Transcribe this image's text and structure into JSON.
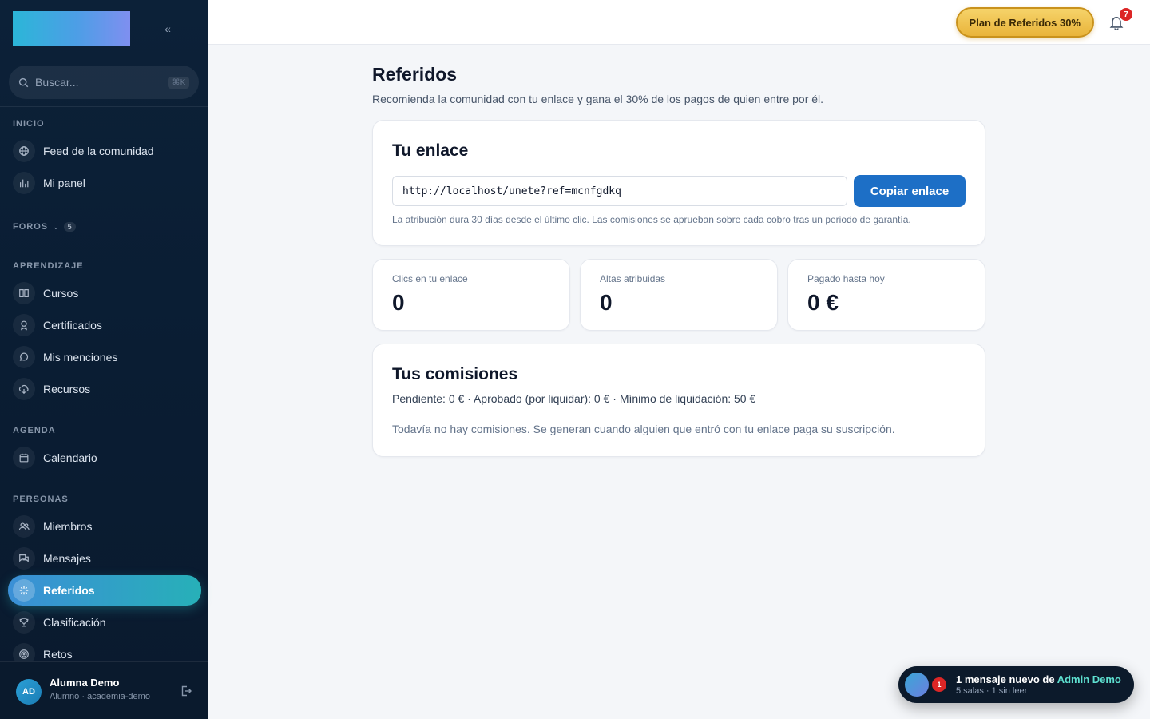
{
  "sidebar": {
    "search": {
      "placeholder": "Buscar...",
      "shortcut": "⌘K"
    },
    "sections": {
      "inicio": "INICIO",
      "foros": "FOROS",
      "foros_count": "5",
      "aprendizaje": "APRENDIZAJE",
      "agenda": "AGENDA",
      "personas": "PERSONAS"
    },
    "items": {
      "feed": "Feed de la comunidad",
      "panel": "Mi panel",
      "cursos": "Cursos",
      "certificados": "Certificados",
      "menciones": "Mis menciones",
      "recursos": "Recursos",
      "calendario": "Calendario",
      "miembros": "Miembros",
      "mensajes": "Mensajes",
      "referidos": "Referidos",
      "clasificacion": "Clasificación",
      "retos": "Retos"
    },
    "user": {
      "initials": "AD",
      "name": "Alumna Demo",
      "role": "Alumno · academia-demo"
    }
  },
  "topbar": {
    "plan_label": "Plan de Referidos 30%",
    "notifications": "7"
  },
  "page": {
    "title": "Referidos",
    "subtitle": "Recomienda la comunidad con tu enlace y gana el 30% de los pagos de quien entre por él."
  },
  "link_card": {
    "title": "Tu enlace",
    "url": "http://localhost/unete?ref=mcnfgdkq",
    "copy_label": "Copiar enlace",
    "note": "La atribución dura 30 días desde el último clic. Las comisiones se aprueban sobre cada cobro tras un periodo de garantía."
  },
  "stats": [
    {
      "label": "Clics en tu enlace",
      "value": "0"
    },
    {
      "label": "Altas atribuidas",
      "value": "0"
    },
    {
      "label": "Pagado hasta hoy",
      "value": "0 €"
    }
  ],
  "commissions": {
    "title": "Tus comisiones",
    "summary": "Pendiente: 0 € · Aprobado (por liquidar): 0 € · Mínimo de liquidación: 50 €",
    "empty": "Todavía no hay comisiones. Se generan cuando alguien que entró con tu enlace paga su suscripción."
  },
  "toast": {
    "badge": "1",
    "prefix": "1 mensaje nuevo de ",
    "sender": "Admin Demo",
    "detail": "5 salas · 1 sin leer"
  },
  "colors": {
    "accent": "#1d6fc6",
    "active_from": "#3b8fd6",
    "active_to": "#27b0b8",
    "gold": "#e9b43a",
    "danger": "#dc2626"
  }
}
